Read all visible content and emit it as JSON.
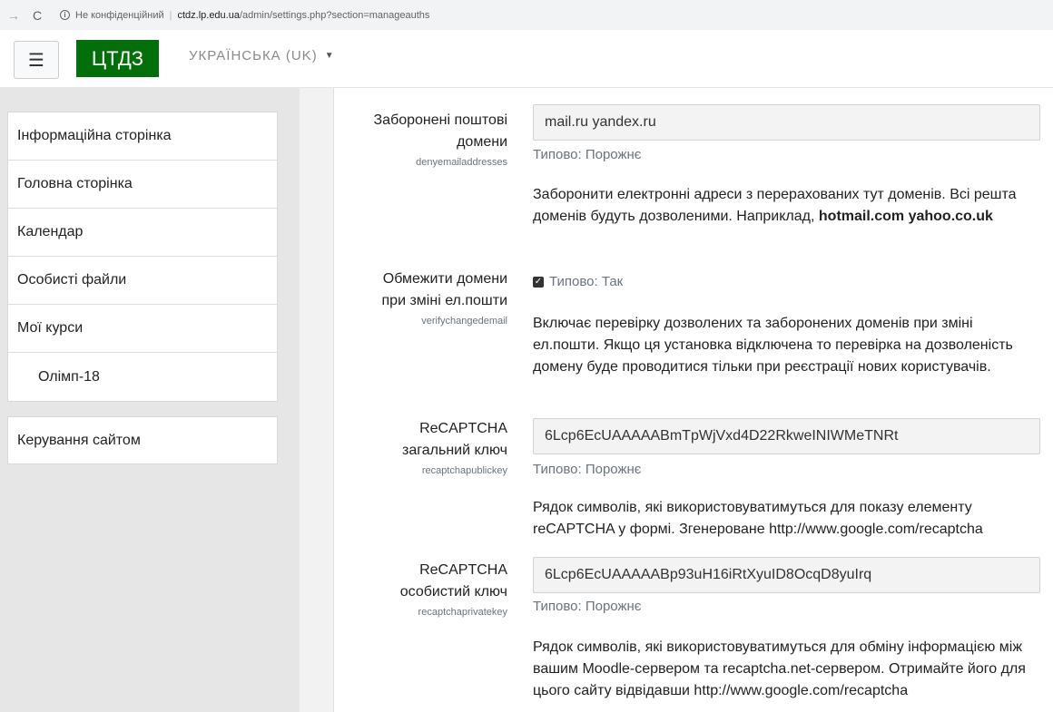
{
  "browser": {
    "secure_label": "Не конфіденційний",
    "host": "ctdz.lp.edu.ua",
    "path": "/admin/settings.php?section=manageauths"
  },
  "navbar": {
    "brand": "ЦТДЗ",
    "language": "УКРАЇНСЬКА (UK)"
  },
  "sidebar": {
    "items": [
      {
        "label": "Інформаційна сторінка"
      },
      {
        "label": "Головна сторінка"
      },
      {
        "label": "Календар"
      },
      {
        "label": "Особисті файли"
      },
      {
        "label": "Мої курси"
      },
      {
        "label": "Олімп-18"
      }
    ],
    "admin": "Керування сайтом"
  },
  "settings": {
    "deny": {
      "label_line1": "Заборонені поштові",
      "label_line2": "домени",
      "key": "denyemailaddresses",
      "value": "mail.ru yandex.ru",
      "default": "Типово: Порожнє",
      "desc_1": "Заборонити електронні адреси з перерахованих тут доменів. Всі решта доменів будуть дозволеними. Наприклад,",
      "desc_bold": "hotmail.com yahoo.co.uk"
    },
    "verify": {
      "label_line1": "Обмежити домени",
      "label_line2": "при зміні ел.пошти",
      "key": "verifychangedemail",
      "default": "Типово: Так",
      "desc": "Включає перевірку дозволених та заборонених доменів при зміні ел.пошти. Якщо ця установка відключена то перевірка на дозволеність домену буде проводитися тільки при реєстрації нових користувачів."
    },
    "public": {
      "label_line1": "ReCAPTCHA",
      "label_line2": "загальний ключ",
      "key": "recaptchapublickey",
      "value": "6Lcp6EcUAAAAABmTpWjVxd4D22RkweINIWMeTNRt",
      "default": "Типово: Порожнє",
      "desc": "Рядок символів, які використовуватимуться для показу елементу reCAPTCHA у формі. Згенероване http://www.google.com/recaptcha"
    },
    "private": {
      "label_line1": "ReCAPTCHA",
      "label_line2": "особистий ключ",
      "key": "recaptchaprivatekey",
      "value": "6Lcp6EcUAAAAABp93uH16iRtXyuID8OcqD8yuIrq",
      "default": "Типово: Порожнє",
      "desc": "Рядок символів, які використовуватимуться для обміну інформацією між вашим Moodle-сервером та recaptcha.net-сервером. Отримайте його для цього сайту відвідавши http://www.google.com/recaptcha"
    }
  }
}
